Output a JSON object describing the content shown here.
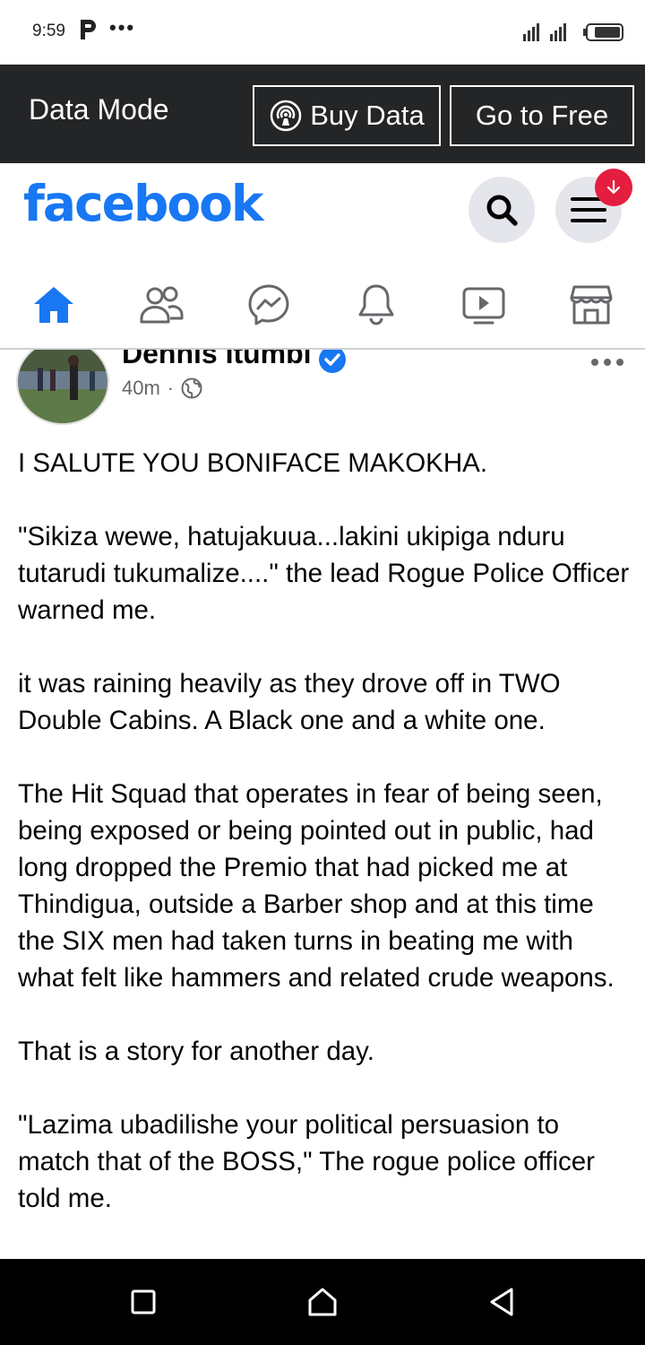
{
  "status_bar": {
    "time": "9:59",
    "notification_icon": "p-app-icon",
    "more_dots": "•••"
  },
  "data_bar": {
    "mode_label": "Data Mode",
    "buy_data_label": "Buy Data",
    "go_free_label": "Go to Free"
  },
  "header": {
    "logo": "facebook",
    "badge_icon": "download-arrow-icon",
    "accent_color": "#1877f2"
  },
  "tabs": [
    {
      "name": "home",
      "icon": "home-icon",
      "active": true
    },
    {
      "name": "friends",
      "icon": "friends-icon",
      "active": false
    },
    {
      "name": "messenger",
      "icon": "messenger-icon",
      "active": false
    },
    {
      "name": "notifications",
      "icon": "bell-icon",
      "active": false
    },
    {
      "name": "watch",
      "icon": "video-icon",
      "active": false
    },
    {
      "name": "marketplace",
      "icon": "marketplace-icon",
      "active": false
    }
  ],
  "post": {
    "author": "Dennis Itumbi",
    "time": "40m",
    "separator": "·",
    "paragraphs": [
      "I SALUTE YOU BONIFACE MAKOKHA.",
      "\"Sikiza wewe, hatujakuua...lakini ukipiga nduru tutarudi tukumalize....\" the lead Rogue Police Officer warned me.",
      "it was raining heavily as they drove off in TWO Double Cabins. A Black one and a white one.",
      "The Hit Squad  that operates in fear of being seen, being exposed or being pointed out in public, had long dropped the Premio that had picked me at Thindigua, outside a Barber shop and at this time the SIX men had taken turns in beating me with what felt like hammers and related crude weapons.",
      "That is a story for another day.",
      "\"Lazima ubadilishe your political persuasion to match that of the BOSS,\" The rogue police officer told me."
    ]
  }
}
